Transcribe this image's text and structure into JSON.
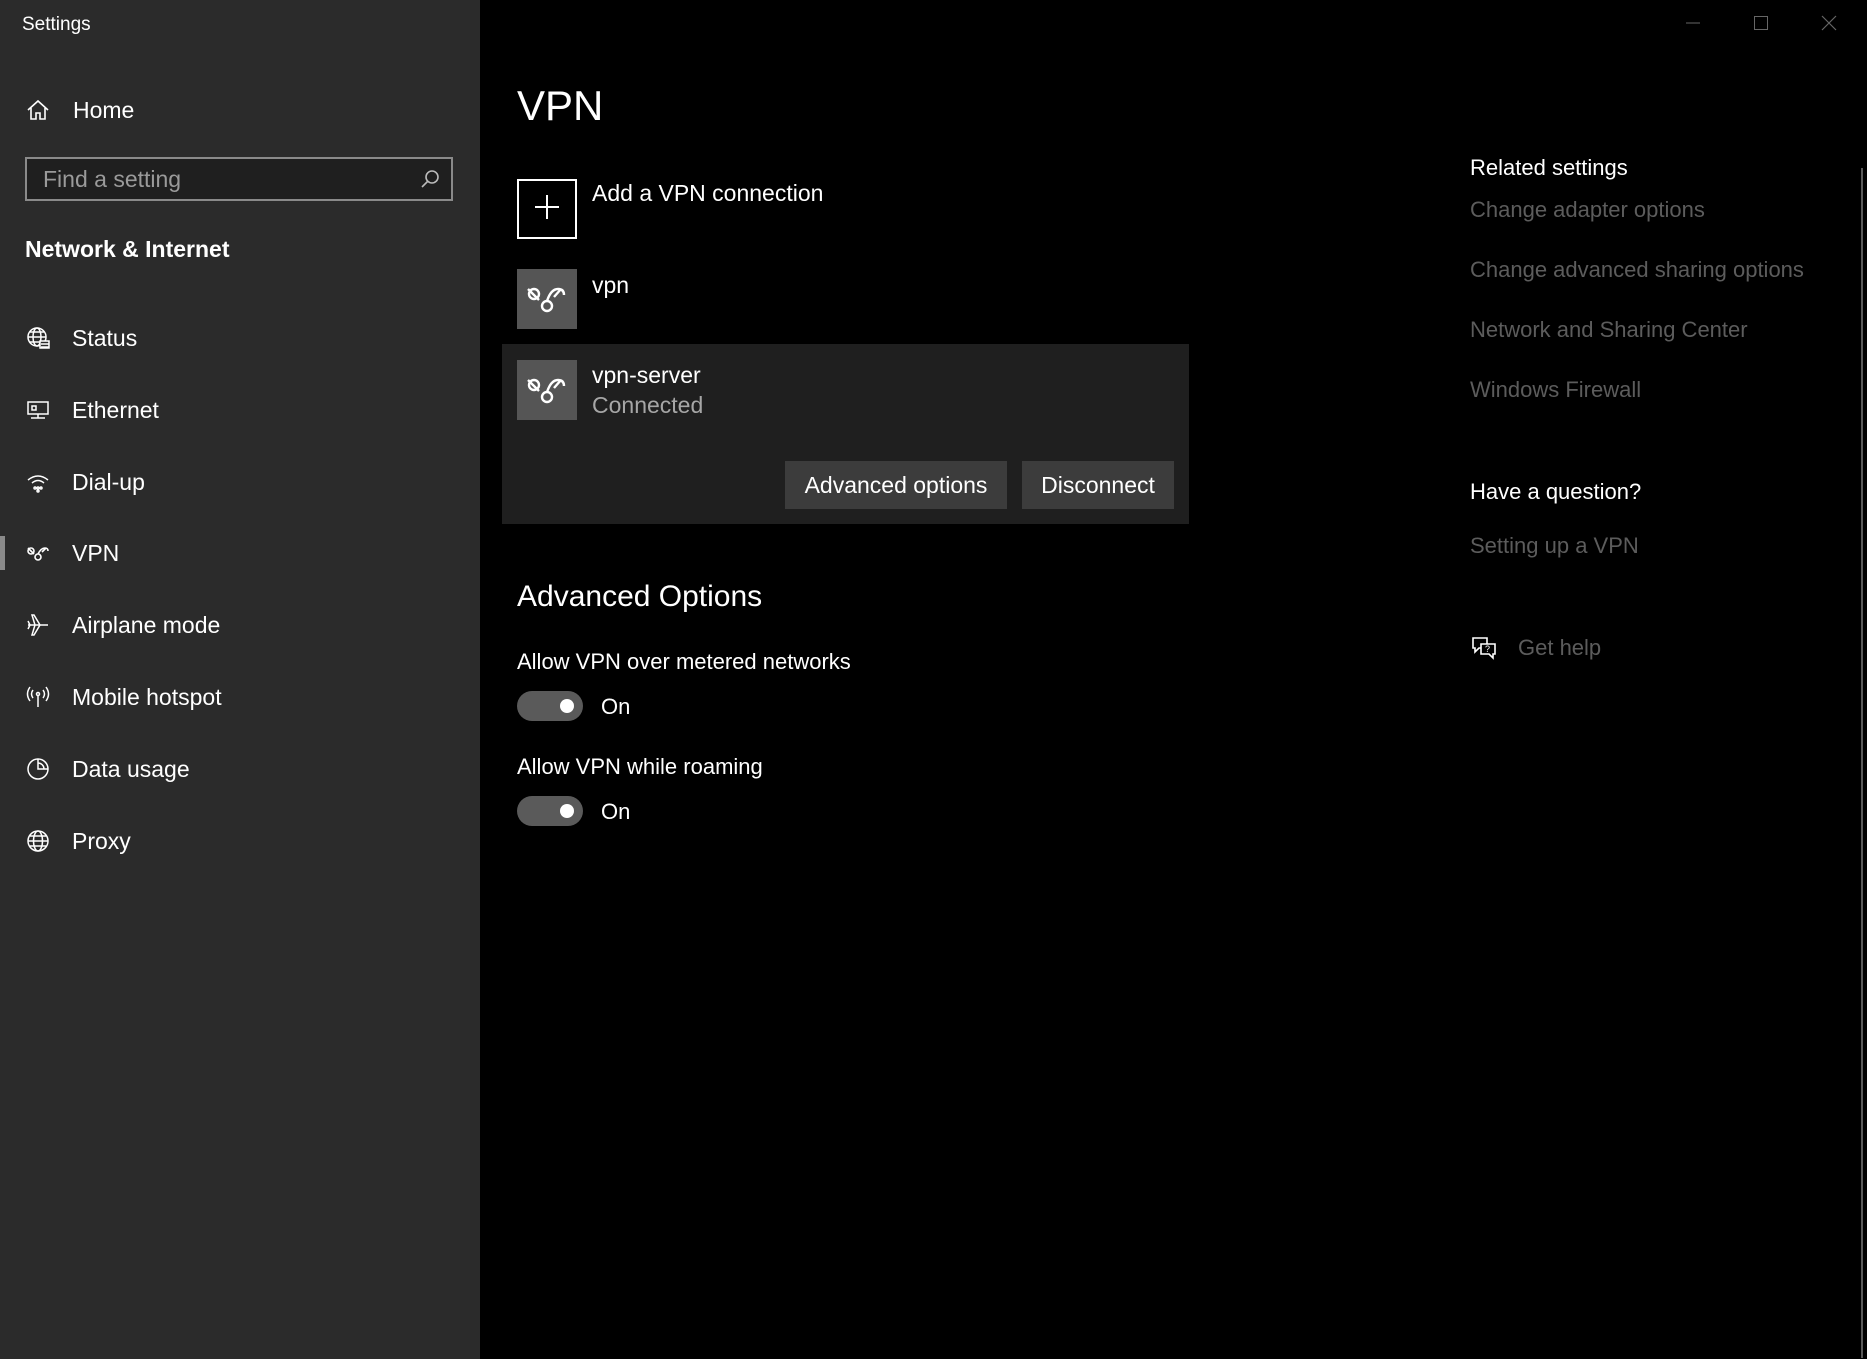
{
  "window": {
    "title": "Settings",
    "controls": {
      "minimize_icon": "minimize-icon",
      "maximize_icon": "maximize-icon",
      "close_icon": "close-icon"
    }
  },
  "sidebar": {
    "home_label": "Home",
    "search": {
      "placeholder": "Find a setting",
      "value": ""
    },
    "section_title": "Network & Internet",
    "items": [
      {
        "label": "Status",
        "icon": "globe-status-icon"
      },
      {
        "label": "Ethernet",
        "icon": "ethernet-icon"
      },
      {
        "label": "Dial-up",
        "icon": "dialup-icon"
      },
      {
        "label": "VPN",
        "icon": "vpn-icon",
        "selected": true
      },
      {
        "label": "Airplane mode",
        "icon": "airplane-icon"
      },
      {
        "label": "Mobile hotspot",
        "icon": "hotspot-icon"
      },
      {
        "label": "Data usage",
        "icon": "data-usage-icon"
      },
      {
        "label": "Proxy",
        "icon": "globe-icon"
      }
    ]
  },
  "main": {
    "title": "VPN",
    "add_connection_label": "Add a VPN connection",
    "connections": [
      {
        "name": "vpn",
        "status": ""
      },
      {
        "name": "vpn-server",
        "status": "Connected"
      }
    ],
    "buttons": {
      "advanced": "Advanced options",
      "disconnect": "Disconnect"
    },
    "advanced_heading": "Advanced Options",
    "toggles": [
      {
        "label": "Allow VPN over metered networks",
        "state": "On"
      },
      {
        "label": "Allow VPN while roaming",
        "state": "On"
      }
    ]
  },
  "related": {
    "heading": "Related settings",
    "links": [
      "Change adapter options",
      "Change advanced sharing options",
      "Network and Sharing Center",
      "Windows Firewall"
    ],
    "question_heading": "Have a question?",
    "question_link": "Setting up a VPN",
    "help_label": "Get help"
  },
  "colors": {
    "sidebar_bg": "#2b2b2b",
    "main_bg": "#000000",
    "selected_panel_bg": "#1f1f1f",
    "button_bg": "#3c3c3c",
    "disabled_link": "#5c5c5c"
  }
}
